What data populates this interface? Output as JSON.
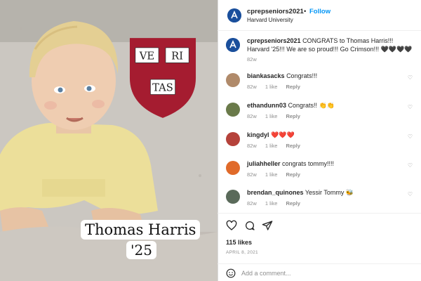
{
  "photo": {
    "caption_name": "Thomas Harris",
    "caption_year": "'25",
    "crest_words": [
      "VE",
      "RI",
      "TAS"
    ]
  },
  "post_header": {
    "username": "cprepseniors2021",
    "separator": "•",
    "follow_label": "Follow",
    "location": "Harvard University"
  },
  "caption": {
    "username": "cprepseniors2021",
    "text": "CONGRATS to Thomas Harris!!! Harvard '25!!! We are so proud!!! Go Crimson!!! 🖤🖤🖤🖤",
    "time": "82w"
  },
  "comments": [
    {
      "username": "biankasacks",
      "text": "Congrats!!!",
      "time": "82w",
      "likes": "1 like",
      "reply": "Reply",
      "avatar_color": "#b08a6a"
    },
    {
      "username": "ethandunn03",
      "text": "Congrats!! 👏👏",
      "time": "82w",
      "likes": "1 like",
      "reply": "Reply",
      "avatar_color": "#6a7a4a"
    },
    {
      "username": "kingdyl",
      "text": "❤️❤️❤️",
      "time": "82w",
      "likes": "1 like",
      "reply": "Reply",
      "avatar_color": "#b5423a"
    },
    {
      "username": "juliahheller",
      "text": "congrats tommy!!!!",
      "time": "82w",
      "likes": "1 like",
      "reply": "Reply",
      "avatar_color": "#e06a2a"
    },
    {
      "username": "brendan_quinones",
      "text": "Yessir Tommy 🐝",
      "time": "82w",
      "likes": "1 like",
      "reply": "Reply",
      "avatar_color": "#5a6a5a"
    }
  ],
  "actions": {
    "icons": [
      "heart-icon",
      "comment-icon",
      "share-icon"
    ],
    "likes": "115 likes",
    "date": "APRIL 8, 2021"
  },
  "comment_box": {
    "placeholder": "Add a comment...",
    "value": ""
  },
  "colors": {
    "follow_blue": "#0095f6",
    "crimson": "#a51c30",
    "muted": "#8e8e8e",
    "brand_avatar": "#1a4f9c"
  }
}
